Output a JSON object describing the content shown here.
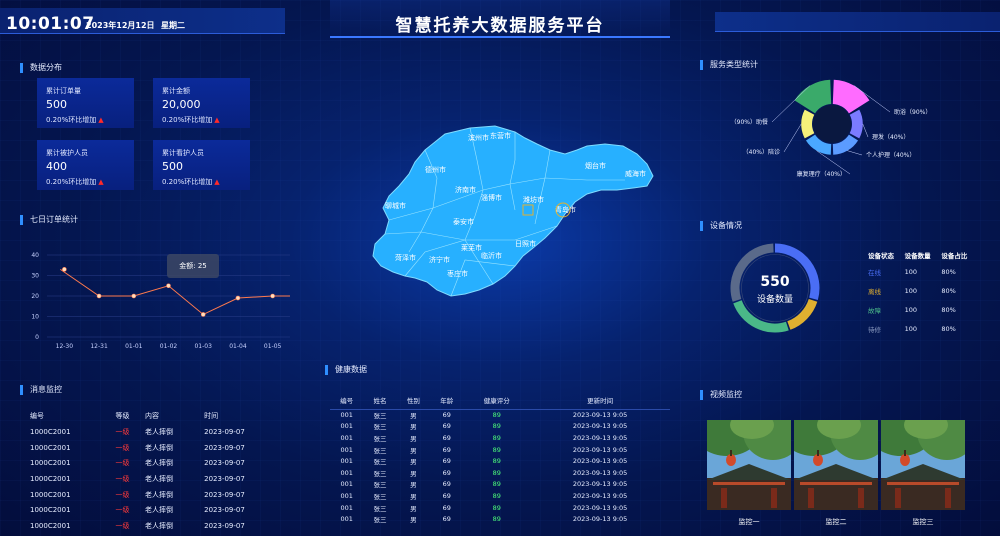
{
  "header": {
    "clock": "10:01:07",
    "date": "2023年12月12日",
    "weekday": "星期二",
    "title": "智慧托养大数据服务平台"
  },
  "sections": {
    "distribution": "数据分布",
    "weekly_orders": "七日订单统计",
    "alerts": "消息监控",
    "health": "健康数据",
    "service_types": "服务类型统计",
    "device_status": "设备情况",
    "video_monitor": "视频监控"
  },
  "stats": [
    {
      "label": "累计订单量",
      "value": "500",
      "change": "0.20%环比增加"
    },
    {
      "label": "累计金额",
      "value": "20,000",
      "change": "0.20%环比增加"
    },
    {
      "label": "累计被护人员",
      "value": "400",
      "change": "0.20%环比增加"
    },
    {
      "label": "累计看护人员",
      "value": "500",
      "change": "0.20%环比增加"
    }
  ],
  "colors": {
    "accent": "#2f8fff",
    "line": "#ff7a4d",
    "alert": "#ff3a3a",
    "good": "#4dff7a",
    "map": "#2fb4ff"
  },
  "chart_data": [
    {
      "type": "line",
      "categories": [
        "12-30",
        "12-31",
        "01-01",
        "01-02",
        "01-03",
        "01-04",
        "01-05"
      ],
      "values": [
        33,
        20,
        20,
        25,
        11,
        19,
        20
      ],
      "ylim": [
        0,
        40
      ],
      "yticks": [
        0,
        10,
        20,
        30,
        40
      ],
      "grid": true,
      "tooltip": "金额: 25"
    },
    {
      "type": "pie",
      "variant": "rose",
      "slices": [
        {
          "label": "助浴（90%）",
          "value": 90,
          "color": "#ff6bff"
        },
        {
          "label": "理发（40%）",
          "value": 40,
          "color": "#7b7bff"
        },
        {
          "label": "个人护理（40%）",
          "value": 40,
          "color": "#5b9bff"
        },
        {
          "label": "康复理疗（40%）",
          "value": 40,
          "color": "#4aa8ff"
        },
        {
          "label": "（40%）陪诊",
          "value": 40,
          "color": "#f5f07a"
        },
        {
          "label": "（90%）助餐",
          "value": 90,
          "color": "#3aaa6a"
        }
      ]
    },
    {
      "type": "pie",
      "variant": "donut",
      "center_value": "550",
      "center_label": "设备数量",
      "slices": [
        {
          "label": "在线",
          "value": 30,
          "color": "#4a6ef5"
        },
        {
          "label": "离线",
          "value": 15,
          "color": "#e0b030"
        },
        {
          "label": "故障",
          "value": 25,
          "color": "#4ab888"
        },
        {
          "label": "待修",
          "value": 30,
          "color": "#5a6a8a"
        }
      ]
    }
  ],
  "alerts": {
    "headers": [
      "编号",
      "等级",
      "内容",
      "时间"
    ],
    "rows": [
      [
        "1000C2001",
        "一级",
        "老人摔倒",
        "2023-09-07"
      ],
      [
        "1000C2001",
        "一级",
        "老人摔倒",
        "2023-09-07"
      ],
      [
        "1000C2001",
        "一级",
        "老人摔倒",
        "2023-09-07"
      ],
      [
        "1000C2001",
        "一级",
        "老人摔倒",
        "2023-09-07"
      ],
      [
        "1000C2001",
        "一级",
        "老人摔倒",
        "2023-09-07"
      ],
      [
        "1000C2001",
        "一级",
        "老人摔倒",
        "2023-09-07"
      ],
      [
        "1000C2001",
        "一级",
        "老人摔倒",
        "2023-09-07"
      ],
      [
        "1000C2001",
        "一级",
        "老人摔倒",
        "2023-09-07"
      ]
    ]
  },
  "health": {
    "headers": [
      "编号",
      "姓名",
      "性别",
      "年龄",
      "健康评分",
      "更新时间"
    ],
    "rows": [
      [
        "001",
        "张三",
        "男",
        "69",
        "89",
        "2023-09-13 9:05"
      ],
      [
        "001",
        "张三",
        "男",
        "69",
        "89",
        "2023-09-13 9:05"
      ],
      [
        "001",
        "张三",
        "男",
        "69",
        "89",
        "2023-09-13 9:05"
      ],
      [
        "001",
        "张三",
        "男",
        "69",
        "89",
        "2023-09-13 9:05"
      ],
      [
        "001",
        "张三",
        "男",
        "69",
        "89",
        "2023-09-13 9:05"
      ],
      [
        "001",
        "张三",
        "男",
        "69",
        "89",
        "2023-09-13 9:05"
      ],
      [
        "001",
        "张三",
        "男",
        "69",
        "89",
        "2023-09-13 9:05"
      ],
      [
        "001",
        "张三",
        "男",
        "69",
        "89",
        "2023-09-13 9:05"
      ],
      [
        "001",
        "张三",
        "男",
        "69",
        "89",
        "2023-09-13 9:05"
      ],
      [
        "001",
        "张三",
        "男",
        "69",
        "89",
        "2023-09-13 9:05"
      ]
    ]
  },
  "device": {
    "headers": [
      "设备状态",
      "设备数量",
      "设备占比"
    ],
    "rows": [
      {
        "status": "在线",
        "count": "100",
        "ratio": "80%",
        "color": "#4a6ef5"
      },
      {
        "status": "离线",
        "count": "100",
        "ratio": "80%",
        "color": "#e0b030"
      },
      {
        "status": "故障",
        "count": "100",
        "ratio": "80%",
        "color": "#4ab888"
      },
      {
        "status": "待修",
        "count": "100",
        "ratio": "80%",
        "color": "#8a9ac0"
      }
    ]
  },
  "map": {
    "cities": [
      "滨州市",
      "东营市",
      "德州市",
      "烟台市",
      "威海市",
      "济南市",
      "淄博市",
      "潍坊市",
      "青岛市",
      "聊城市",
      "泰安市",
      "莱芜市",
      "日照市",
      "菏泽市",
      "济宁市",
      "临沂市",
      "枣庄市"
    ]
  },
  "cameras": [
    "监控一",
    "监控二",
    "监控三"
  ]
}
